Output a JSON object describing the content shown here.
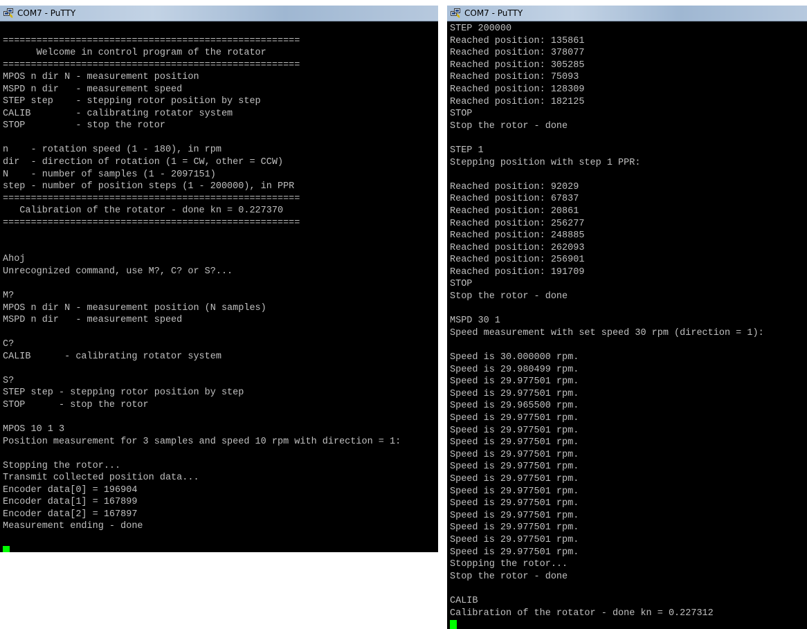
{
  "windows": [
    {
      "title": "COM7 - PuTTY",
      "lines": [
        "",
        "=====================================================",
        "      Welcome in control program of the rotator",
        "=====================================================",
        "MPOS n dir N - measurement position",
        "MSPD n dir   - measurement speed",
        "STEP step    - stepping rotor position by step",
        "CALIB        - calibrating rotator system",
        "STOP         - stop the rotor",
        "",
        "n    - rotation speed (1 - 180), in rpm",
        "dir  - direction of rotation (1 = CW, other = CCW)",
        "N    - number of samples (1 - 2097151)",
        "step - number of position steps (1 - 200000), in PPR",
        "=====================================================",
        "   Calibration of the rotator - done kn = 0.227370",
        "=====================================================",
        "",
        "",
        "Ahoj",
        "Unrecognized command, use M?, C? or S?...",
        "",
        "M?",
        "MPOS n dir N - measurement position (N samples)",
        "MSPD n dir   - measurement speed",
        "",
        "C?",
        "CALIB      - calibrating rotator system",
        "",
        "S?",
        "STEP step - stepping rotor position by step",
        "STOP      - stop the rotor",
        "",
        "MPOS 10 1 3",
        "Position measurement for 3 samples and speed 10 rpm with direction = 1:",
        "",
        "Stopping the rotor...",
        "Transmit collected position data...",
        "Encoder data[0] = 196904",
        "Encoder data[1] = 167899",
        "Encoder data[2] = 167897",
        "Measurement ending - done",
        ""
      ]
    },
    {
      "title": "COM7 - PuTTY",
      "lines": [
        "STEP 200000",
        "Reached position: 135861",
        "Reached position: 378077",
        "Reached position: 305285",
        "Reached position: 75093",
        "Reached position: 128309",
        "Reached position: 182125",
        "STOP",
        "Stop the rotor - done",
        "",
        "STEP 1",
        "Stepping position with step 1 PPR:",
        "",
        "Reached position: 92029",
        "Reached position: 67837",
        "Reached position: 20861",
        "Reached position: 256277",
        "Reached position: 248885",
        "Reached position: 262093",
        "Reached position: 256901",
        "Reached position: 191709",
        "STOP",
        "Stop the rotor - done",
        "",
        "MSPD 30 1",
        "Speed measurement with set speed 30 rpm (direction = 1):",
        "",
        "Speed is 30.000000 rpm.",
        "Speed is 29.980499 rpm.",
        "Speed is 29.977501 rpm.",
        "Speed is 29.977501 rpm.",
        "Speed is 29.965500 rpm.",
        "Speed is 29.977501 rpm.",
        "Speed is 29.977501 rpm.",
        "Speed is 29.977501 rpm.",
        "Speed is 29.977501 rpm.",
        "Speed is 29.977501 rpm.",
        "Speed is 29.977501 rpm.",
        "Speed is 29.977501 rpm.",
        "Speed is 29.977501 rpm.",
        "Speed is 29.977501 rpm.",
        "Speed is 29.977501 rpm.",
        "Speed is 29.977501 rpm.",
        "Speed is 29.977501 rpm.",
        "Stopping the rotor...",
        "Stop the rotor - done",
        "",
        "CALIB",
        "Calibration of the rotator - done kn = 0.227312"
      ]
    }
  ],
  "colors": {
    "terminal_bg": "#000000",
    "terminal_fg": "#c0c0c0",
    "cursor": "#00ff00"
  },
  "icons": {
    "titlebar": "putty-icon"
  }
}
